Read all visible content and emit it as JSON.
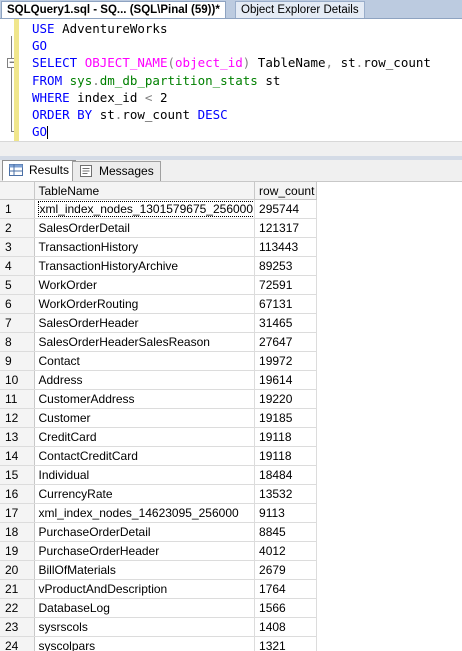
{
  "tabs": [
    {
      "label": "SQLQuery1.sql - SQ... (SQL\\Pinal (59))*",
      "active": true
    },
    {
      "label": "Object Explorer Details",
      "active": false
    }
  ],
  "editor": {
    "collapse_glyph": "−",
    "lines": [
      [
        {
          "t": "USE ",
          "c": "kw"
        },
        {
          "t": "AdventureWorks",
          "c": "tx"
        }
      ],
      [
        {
          "t": "GO",
          "c": "kw"
        }
      ],
      [
        {
          "t": "SELECT ",
          "c": "kw"
        },
        {
          "t": "OBJECT_NAME",
          "c": "fn"
        },
        {
          "t": "(",
          "c": "op"
        },
        {
          "t": "object_id",
          "c": "fn"
        },
        {
          "t": ")",
          "c": "op"
        },
        {
          "t": " TableName",
          "c": "tx"
        },
        {
          "t": ",",
          "c": "op"
        },
        {
          "t": " st",
          "c": "tx"
        },
        {
          "t": ".",
          "c": "op"
        },
        {
          "t": "row_count",
          "c": "tx"
        }
      ],
      [
        {
          "t": "FROM ",
          "c": "kw"
        },
        {
          "t": "sys",
          "c": "sy"
        },
        {
          "t": ".",
          "c": "op"
        },
        {
          "t": "dm_db_partition_stats",
          "c": "sy"
        },
        {
          "t": " st",
          "c": "tx"
        }
      ],
      [
        {
          "t": "WHERE ",
          "c": "kw"
        },
        {
          "t": "index_id ",
          "c": "tx"
        },
        {
          "t": "<",
          "c": "op"
        },
        {
          "t": " 2",
          "c": "tx"
        }
      ],
      [
        {
          "t": "ORDER BY ",
          "c": "kw"
        },
        {
          "t": "st",
          "c": "tx"
        },
        {
          "t": ".",
          "c": "op"
        },
        {
          "t": "row_count ",
          "c": "tx"
        },
        {
          "t": "DESC",
          "c": "kw"
        }
      ],
      [
        {
          "t": "GO",
          "c": "kw"
        }
      ]
    ]
  },
  "result_tabs": [
    {
      "label": "Results",
      "icon": "grid-icon"
    },
    {
      "label": "Messages",
      "icon": "messages-icon"
    }
  ],
  "grid": {
    "columns": [
      "TableName",
      "row_count"
    ],
    "rows": [
      [
        "1",
        "xml_index_nodes_1301579675_256000",
        "295744"
      ],
      [
        "2",
        "SalesOrderDetail",
        "121317"
      ],
      [
        "3",
        "TransactionHistory",
        "113443"
      ],
      [
        "4",
        "TransactionHistoryArchive",
        "89253"
      ],
      [
        "5",
        "WorkOrder",
        "72591"
      ],
      [
        "6",
        "WorkOrderRouting",
        "67131"
      ],
      [
        "7",
        "SalesOrderHeader",
        "31465"
      ],
      [
        "8",
        "SalesOrderHeaderSalesReason",
        "27647"
      ],
      [
        "9",
        "Contact",
        "19972"
      ],
      [
        "10",
        "Address",
        "19614"
      ],
      [
        "11",
        "CustomerAddress",
        "19220"
      ],
      [
        "12",
        "Customer",
        "19185"
      ],
      [
        "13",
        "CreditCard",
        "19118"
      ],
      [
        "14",
        "ContactCreditCard",
        "19118"
      ],
      [
        "15",
        "Individual",
        "18484"
      ],
      [
        "16",
        "CurrencyRate",
        "13532"
      ],
      [
        "17",
        "xml_index_nodes_14623095_256000",
        "9113"
      ],
      [
        "18",
        "PurchaseOrderDetail",
        "8845"
      ],
      [
        "19",
        "PurchaseOrderHeader",
        "4012"
      ],
      [
        "20",
        "BillOfMaterials",
        "2679"
      ],
      [
        "21",
        "vProductAndDescription",
        "1764"
      ],
      [
        "22",
        "DatabaseLog",
        "1566"
      ],
      [
        "23",
        "sysrscols",
        "1408"
      ],
      [
        "24",
        "syscolpars",
        "1321"
      ]
    ]
  }
}
